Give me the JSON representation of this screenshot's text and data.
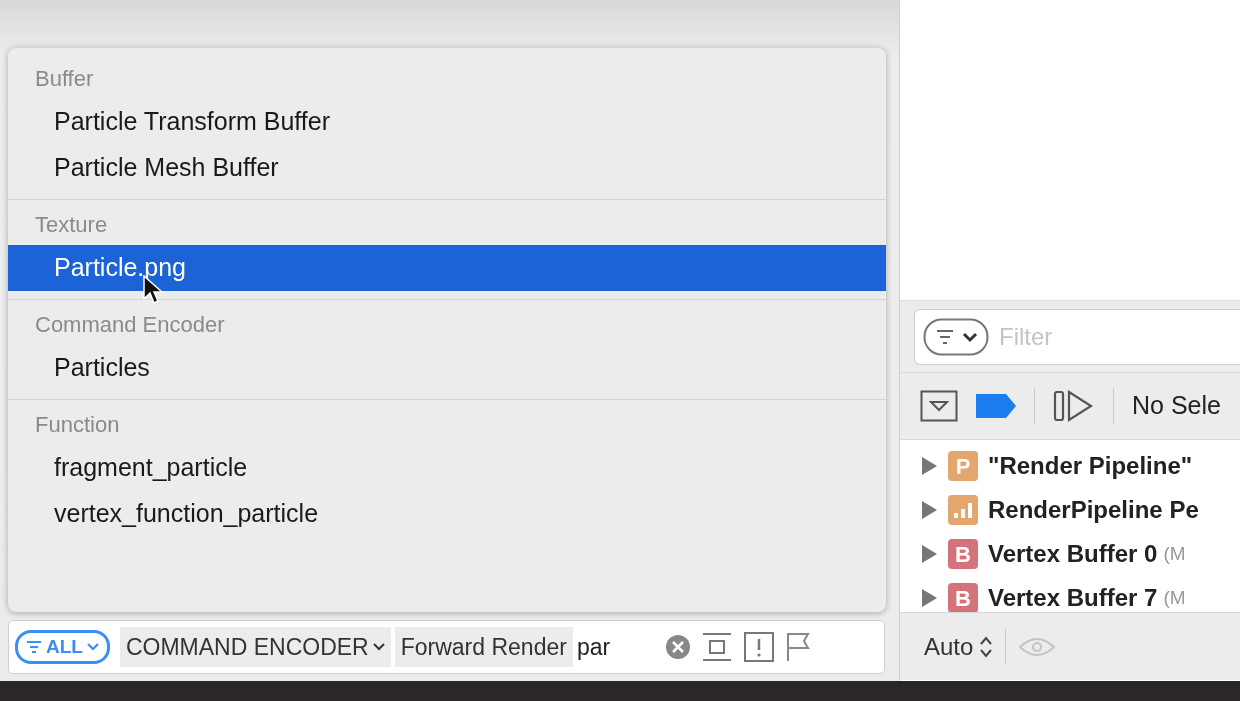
{
  "popup": {
    "sections": [
      {
        "header": "Buffer",
        "items": [
          {
            "label": "Particle Transform Buffer",
            "selected": false
          },
          {
            "label": "Particle Mesh Buffer",
            "selected": false
          }
        ]
      },
      {
        "header": "Texture",
        "items": [
          {
            "label": "Particle.png",
            "selected": true
          }
        ]
      },
      {
        "header": "Command Encoder",
        "items": [
          {
            "label": "Particles",
            "selected": false
          }
        ]
      },
      {
        "header": "Function",
        "items": [
          {
            "label": "fragment_particle",
            "selected": false
          },
          {
            "label": "vertex_function_particle",
            "selected": false
          }
        ]
      }
    ]
  },
  "search_bar": {
    "scope": "ALL",
    "tokens": [
      {
        "label": "COMMAND ENCODER",
        "menu": true
      },
      {
        "label": "Forward Render",
        "menu": false
      }
    ],
    "value": "par"
  },
  "right_panel": {
    "filter": {
      "placeholder": "Filter"
    },
    "selection_label": "No Sele",
    "rows": [
      {
        "kind": "letter",
        "badge": "P",
        "color": "#e2a66e",
        "label": "\"Render Pipeline\"",
        "expanded": false
      },
      {
        "kind": "chart",
        "color": "#e2a66e",
        "label": "RenderPipeline Pe",
        "expanded": false
      },
      {
        "kind": "letter",
        "badge": "B",
        "color": "#d4747a",
        "label": "Vertex Buffer 0",
        "detail": "(M",
        "expanded": false
      },
      {
        "kind": "letter",
        "badge": "B",
        "color": "#d4747a",
        "label": "Vertex Buffer 7",
        "detail": "(M",
        "expanded": false
      }
    ],
    "footer": {
      "mode": "Auto"
    }
  }
}
